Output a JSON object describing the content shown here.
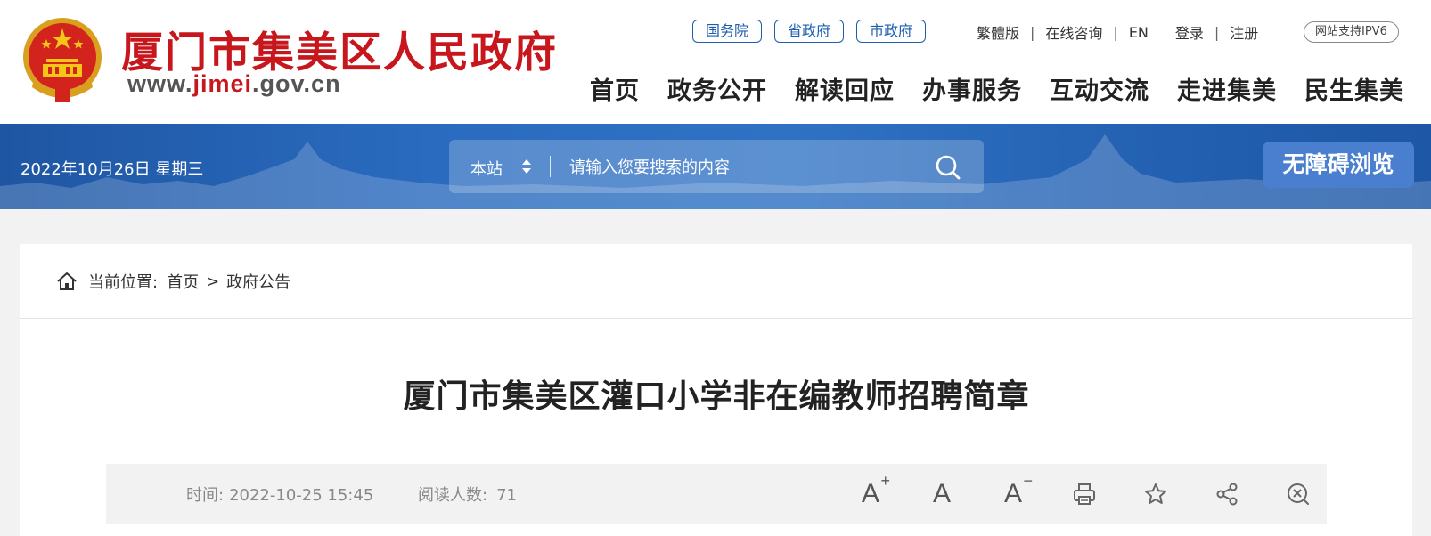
{
  "header": {
    "site_title": "厦门市集美区人民政府",
    "domain": {
      "prefix": "www.",
      "highlight": "jimei",
      "suffix": ".gov.cn"
    },
    "gov_links": [
      {
        "label": "国务院"
      },
      {
        "label": "省政府"
      },
      {
        "label": "市政府"
      }
    ],
    "util_links": {
      "traditional": "繁體版",
      "consult": "在线咨询",
      "english": "EN",
      "login": "登录",
      "register": "注册",
      "separator": "|"
    },
    "ipv6_badge": "网站支持IPV6",
    "nav": [
      {
        "label": "首页"
      },
      {
        "label": "政务公开"
      },
      {
        "label": "解读回应"
      },
      {
        "label": "办事服务"
      },
      {
        "label": "互动交流"
      },
      {
        "label": "走进集美"
      },
      {
        "label": "民生集美"
      }
    ]
  },
  "banner": {
    "date": "2022年10月26日 星期三",
    "search": {
      "scope": "本站",
      "placeholder": "请输入您要搜索的内容",
      "icon": "search-icon"
    },
    "accessibility_label": "无障碍浏览"
  },
  "content": {
    "breadcrumb": {
      "icon": "home-icon",
      "prefix": "当前位置:",
      "items": [
        {
          "label": "首页"
        },
        {
          "label": "政府公告"
        }
      ],
      "separator": ">"
    },
    "article": {
      "title": "厦门市集美区灌口小学非在编教师招聘简章",
      "time_label": "时间:",
      "time_value": "2022-10-25 15:45",
      "views_label": "阅读人数:",
      "views_value": "71"
    },
    "tools": [
      {
        "name": "font-increase",
        "glyph": "A",
        "sup": "+"
      },
      {
        "name": "font-reset",
        "glyph": "A",
        "sup": ""
      },
      {
        "name": "font-decrease",
        "glyph": "A",
        "sup": "−"
      },
      {
        "name": "print-icon"
      },
      {
        "name": "star-icon"
      },
      {
        "name": "share-icon"
      },
      {
        "name": "close-icon"
      }
    ]
  },
  "colors": {
    "brand_red": "#c8161d",
    "brand_blue": "#1d5fae",
    "banner_blue": "#2a6bbf",
    "accessibility_button": "#4a7fd0"
  }
}
